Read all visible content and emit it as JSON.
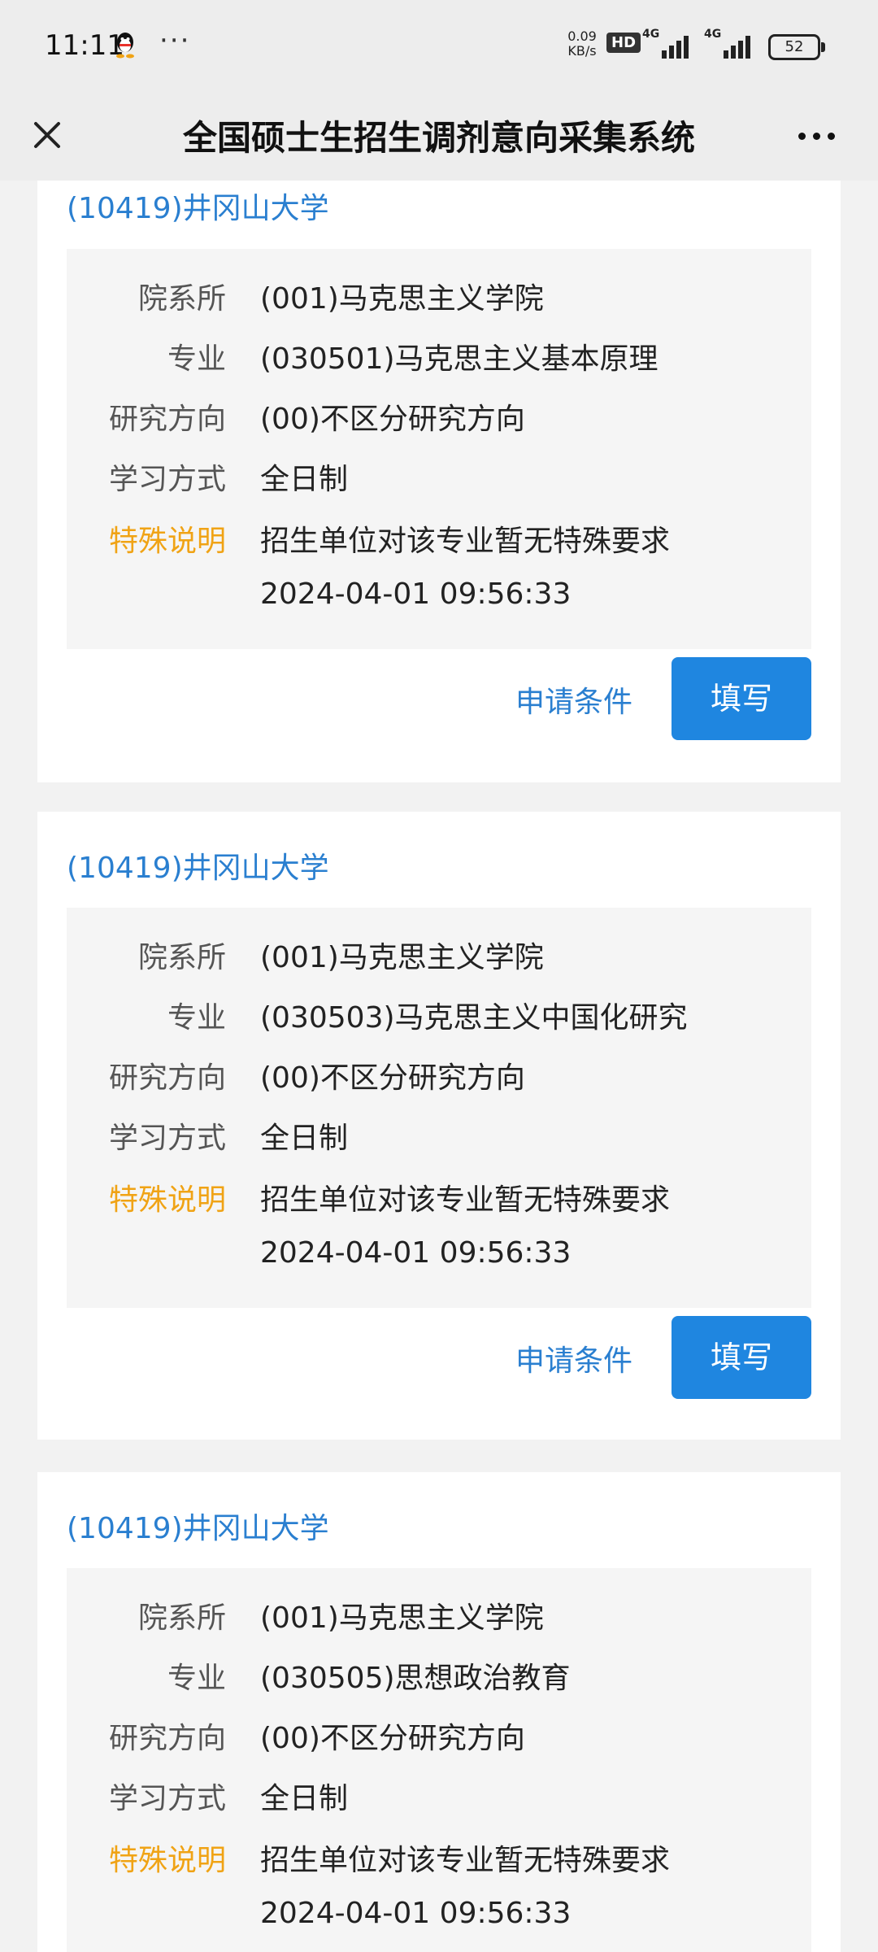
{
  "status_bar": {
    "time": "11:11",
    "more": "···",
    "speed_value": "0.09",
    "speed_unit": "KB/s",
    "hd": "HD",
    "network1": "4G",
    "network2": "4G",
    "battery": "52"
  },
  "header": {
    "title": "全国硕士生招生调剂意向采集系统"
  },
  "labels": {
    "dept": "院系所",
    "major": "专业",
    "direction": "研究方向",
    "mode": "学习方式",
    "special": "特殊说明"
  },
  "buttons": {
    "conditions": "申请条件",
    "fill": "填写"
  },
  "cards": [
    {
      "university": "(10419)井冈山大学",
      "dept": "(001)马克思主义学院",
      "major": "(030501)马克思主义基本原理",
      "direction": "(00)不区分研究方向",
      "mode": "全日制",
      "special": "招生单位对该专业暂无特殊要求",
      "timestamp": "2024-04-01 09:56:33"
    },
    {
      "university": "(10419)井冈山大学",
      "dept": "(001)马克思主义学院",
      "major": "(030503)马克思主义中国化研究",
      "direction": "(00)不区分研究方向",
      "mode": "全日制",
      "special": "招生单位对该专业暂无特殊要求",
      "timestamp": "2024-04-01 09:56:33"
    },
    {
      "university": "(10419)井冈山大学",
      "dept": "(001)马克思主义学院",
      "major": "(030505)思想政治教育",
      "direction": "(00)不区分研究方向",
      "mode": "全日制",
      "special": "招生单位对该专业暂无特殊要求",
      "timestamp": "2024-04-01 09:56:33"
    }
  ]
}
